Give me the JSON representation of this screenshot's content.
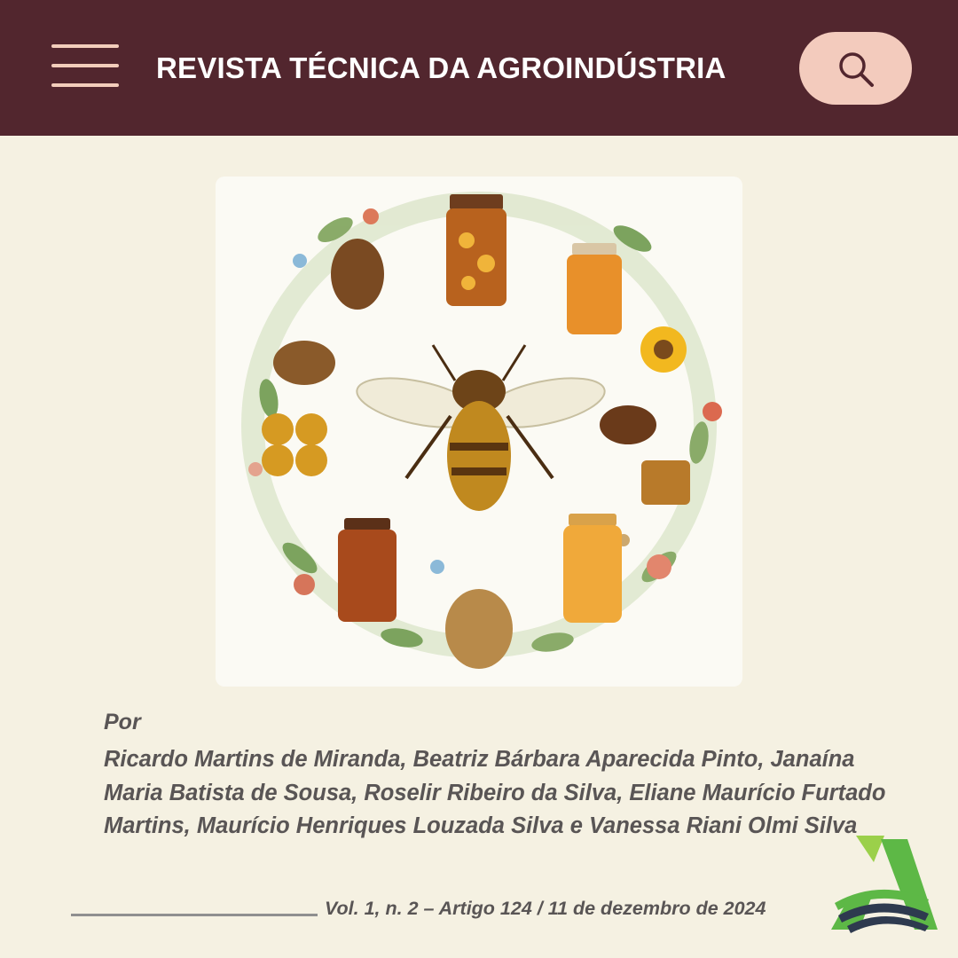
{
  "header": {
    "title": "REVISTA TÉCNICA DA AGROINDÚSTRIA",
    "menu_icon": "hamburger-menu-icon",
    "search_icon": "magnifier-icon",
    "background": "#52262e",
    "accent": "#f3cbbd"
  },
  "article": {
    "byline_label": "Por",
    "authors": "Ricardo Martins de Miranda, Beatriz Bárbara Aparecida Pinto, Janaína Maria Batista de Sousa, Roselir Ribeiro da Silva, Eliane Maurício Furtado Martins, Maurício Henriques Louzada Silva e Vanessa Riani Olmi Silva",
    "volume_info": "Vol. 1, n. 2 – Artigo 124 / 11 de dezembro de 2024"
  },
  "colors": {
    "page_background": "#f5f1e2",
    "text": "#595555",
    "logo_green": "#5db846",
    "logo_navy": "#2e3a4f"
  }
}
